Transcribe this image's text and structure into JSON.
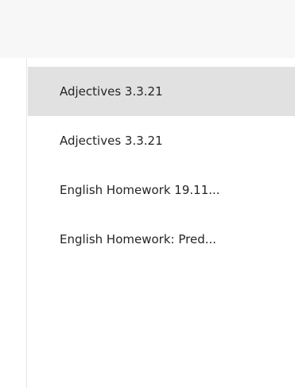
{
  "pages": {
    "items": [
      {
        "label": "Adjectives 3.3.21",
        "selected": true
      },
      {
        "label": "Adjectives 3.3.21",
        "selected": false
      },
      {
        "label": "English Homework 19.11...",
        "selected": false
      },
      {
        "label": "English Homework: Pred...",
        "selected": false
      }
    ]
  },
  "colors": {
    "selected_bg": "#e1e1e1",
    "top_bar_bg": "#f7f7f7",
    "text": "#252525"
  }
}
